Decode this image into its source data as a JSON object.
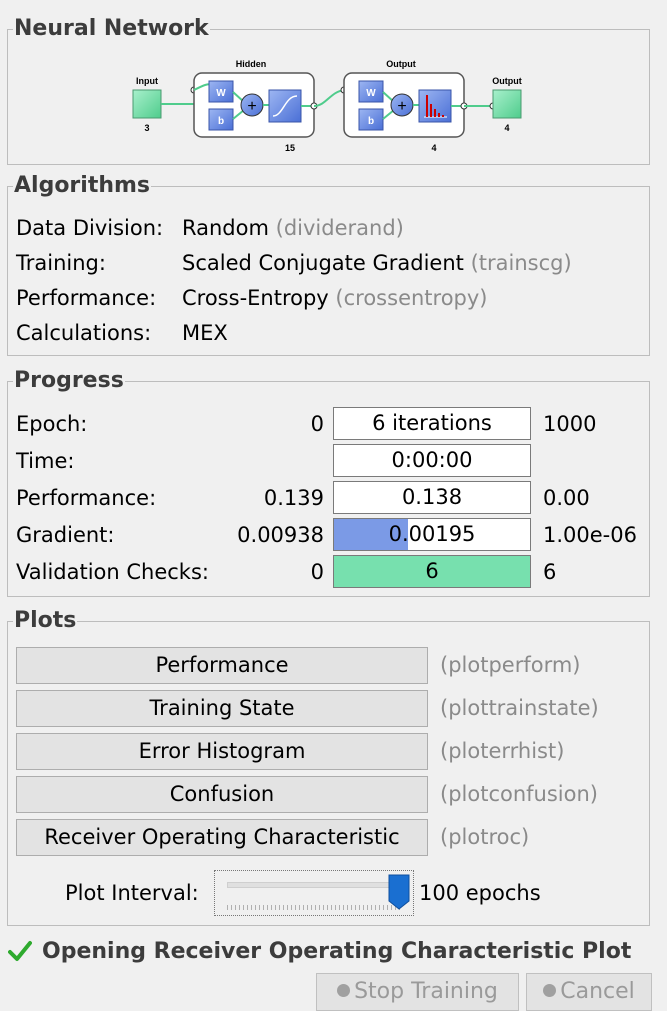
{
  "neural_network": {
    "title": "Neural Network",
    "input_label": "Input",
    "input_size": "3",
    "hidden_label": "Hidden",
    "hidden_size": "15",
    "output_layer_label": "Output",
    "output_layer_size": "4",
    "output_label": "Output",
    "output_size": "4",
    "weight_label": "W",
    "bias_label": "b",
    "sum_symbol": "+"
  },
  "algorithms": {
    "title": "Algorithms",
    "rows": [
      {
        "label": "Data Division:",
        "value": "Random",
        "fn": "(dividerand)"
      },
      {
        "label": "Training:",
        "value": "Scaled Conjugate Gradient",
        "fn": "(trainscg)"
      },
      {
        "label": "Performance:",
        "value": "Cross-Entropy",
        "fn": "(crossentropy)"
      },
      {
        "label": "Calculations:",
        "value": "MEX",
        "fn": ""
      }
    ]
  },
  "progress": {
    "title": "Progress",
    "rows": [
      {
        "label": "Epoch:",
        "start": "0",
        "current": "6 iterations",
        "end": "1000",
        "fill": 0,
        "fill_color": "#ffffff"
      },
      {
        "label": "Time:",
        "start": "",
        "current": "0:00:00",
        "end": "",
        "fill": 0,
        "fill_color": "#ffffff"
      },
      {
        "label": "Performance:",
        "start": "0.139",
        "current": "0.138",
        "end": "0.00",
        "fill": 0,
        "fill_color": "#ffffff"
      },
      {
        "label": "Gradient:",
        "start": "0.00938",
        "current": "0.00195",
        "end": "1.00e-06",
        "fill": 0.38,
        "fill_color": "#7b9ae6"
      },
      {
        "label": "Validation Checks:",
        "start": "0",
        "current": "6",
        "end": "6",
        "fill": 1.0,
        "fill_color": "#77e0ae"
      }
    ]
  },
  "plots": {
    "title": "Plots",
    "buttons": [
      {
        "label": "Performance",
        "fn": "(plotperform)"
      },
      {
        "label": "Training State",
        "fn": "(plottrainstate)"
      },
      {
        "label": "Error Histogram",
        "fn": "(ploterrhist)"
      },
      {
        "label": "Confusion",
        "fn": "(plotconfusion)"
      },
      {
        "label": "Receiver Operating Characteristic",
        "fn": "(plotroc)"
      }
    ],
    "interval_label": "Plot Interval:",
    "interval_value": "100 epochs",
    "slider_fraction": 1.0
  },
  "status": {
    "message": "Opening Receiver Operating Characteristic Plot",
    "icon": "checkmark-icon"
  },
  "footer": {
    "stop_label": "Stop Training",
    "cancel_label": "Cancel"
  },
  "colors": {
    "layer_green": "#77e0ae",
    "layer_blue": "#6d8fe3",
    "gradient_fill": "#7b9ae6",
    "validation_fill": "#77e0ae",
    "slider_thumb": "#1a6fd1",
    "check_green": "#2eaa2e"
  }
}
